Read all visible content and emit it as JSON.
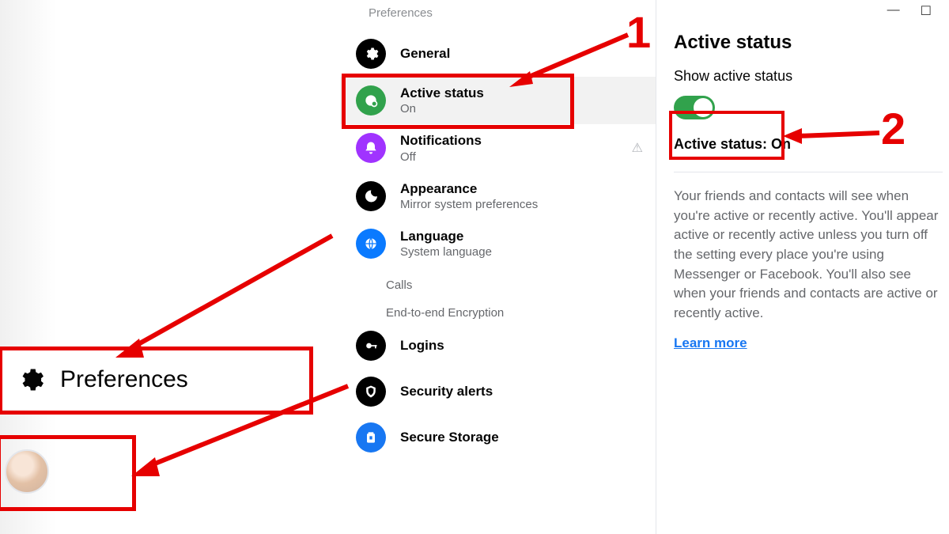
{
  "windowTitle": "Preferences",
  "prefs": {
    "title": "Preferences",
    "items": [
      {
        "label": "General"
      },
      {
        "label": "Active status",
        "sub": "On"
      },
      {
        "label": "Notifications",
        "sub": "Off"
      },
      {
        "label": "Appearance",
        "sub": "Mirror system preferences"
      },
      {
        "label": "Language",
        "sub": "System language"
      }
    ],
    "sectionCalls": "Calls",
    "sectionE2ee": "End-to-end Encryption",
    "logins": "Logins",
    "security": "Security alerts",
    "storage": "Secure Storage"
  },
  "detail": {
    "title": "Active status",
    "showLabel": "Show active status",
    "statusLine": "Active status: On",
    "desc": "Your friends and contacts will see when you're active or recently active. You'll appear active or recently active unless you turn off the setting every place you're using Messenger or Facebook. You'll also see when your friends and contacts are active or recently active.",
    "learn": "Learn more"
  },
  "leftPopout": {
    "label": "Preferences"
  },
  "callouts": {
    "one": "1",
    "two": "2"
  }
}
